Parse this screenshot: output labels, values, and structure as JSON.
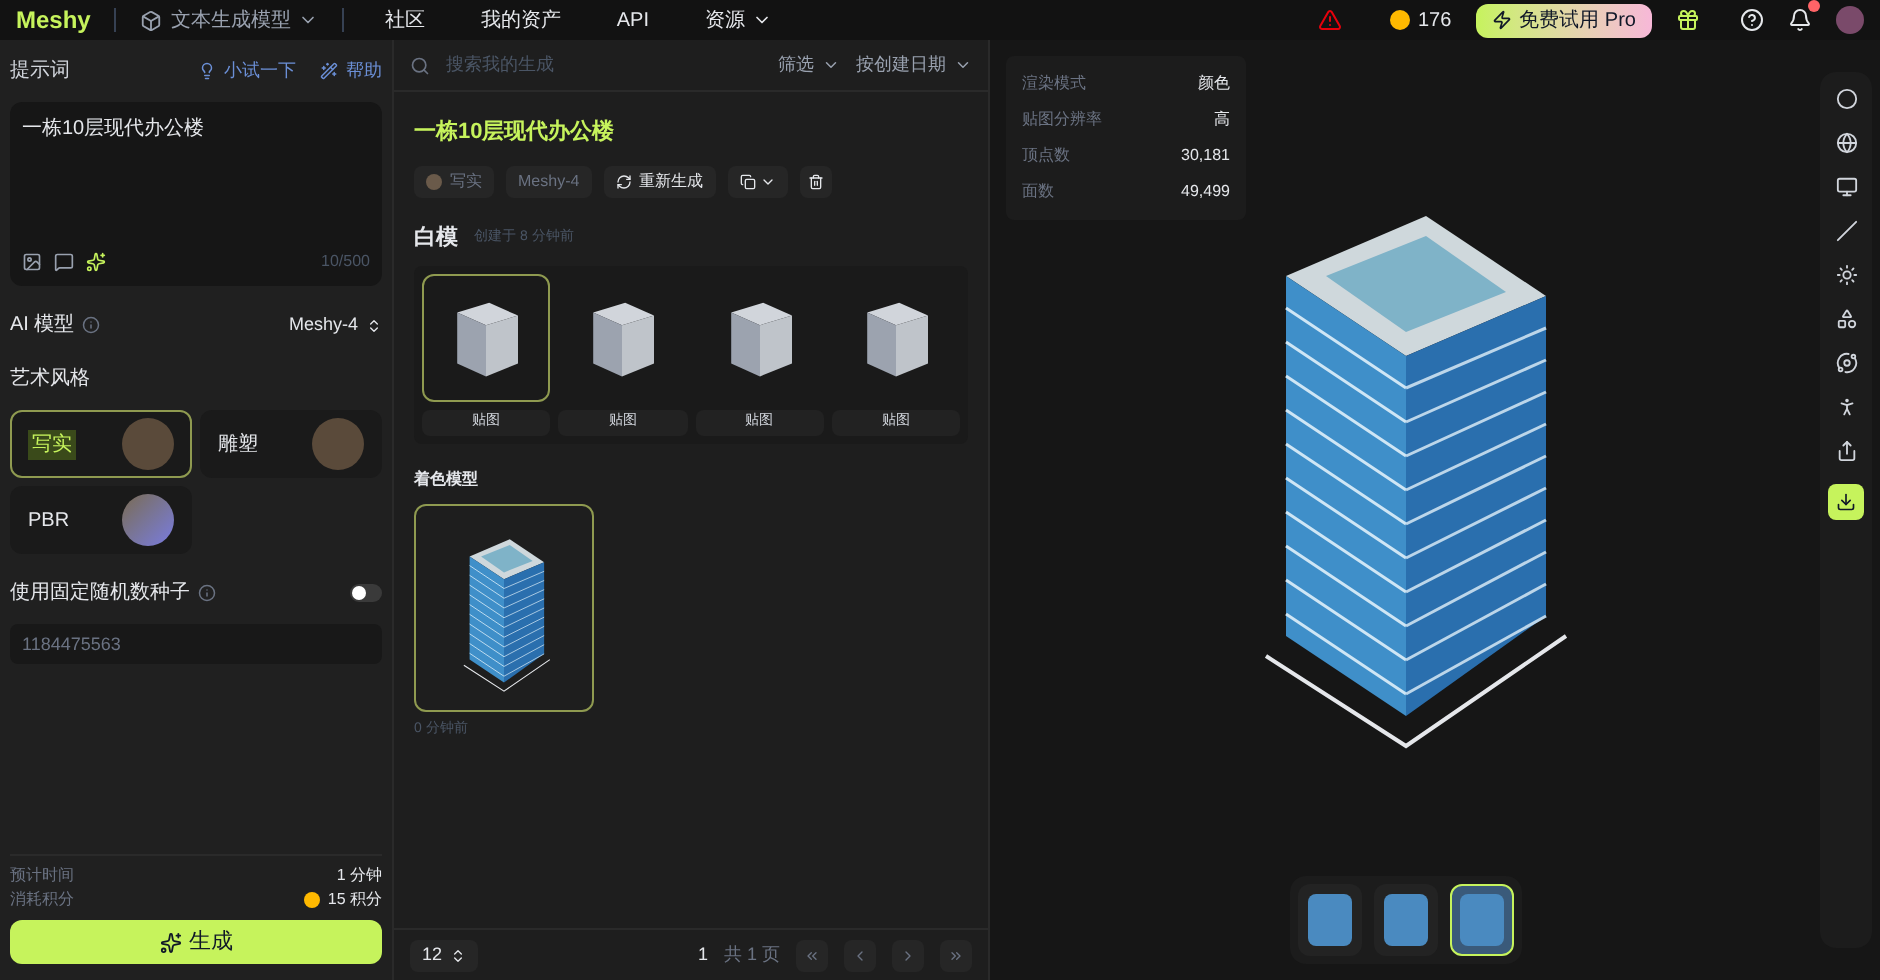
{
  "header": {
    "logo": "Meshy",
    "mode": "文本生成模型",
    "nav": [
      {
        "label": "社区",
        "menu": false
      },
      {
        "label": "我的资产",
        "menu": false
      },
      {
        "label": "API",
        "menu": false
      },
      {
        "label": "资源",
        "menu": true
      }
    ],
    "credits": "176",
    "pro": "免费试用 Pro",
    "notification_badge": true
  },
  "left_panel": {
    "prompt_label": "提示词",
    "prompt_actions": [
      "小试一下",
      "帮助"
    ],
    "prompt": "一栋10层现代办公楼",
    "counter": "10/500",
    "model_label": "AI 模型",
    "model": "Meshy-4",
    "style_label": "艺术风格",
    "styles": [
      {
        "label": "写实",
        "selected": true
      },
      {
        "label": "雕塑",
        "selected": false
      },
      {
        "label": "PBR",
        "selected": false
      }
    ],
    "seed_label": "使用固定随机数种子",
    "seed_on": false,
    "seed_placeholder": "1184475563",
    "estimates": [
      {
        "label": "预计时间",
        "value": "1 分钟"
      },
      {
        "label": "消耗积分",
        "value": "15 积分"
      }
    ],
    "generate": "生成"
  },
  "middle_panel": {
    "search_placeholder": "搜索我的生成",
    "filter": "筛选",
    "sort": "按创建日期",
    "title": "一栋10层现代办公楼",
    "style_tag": "写实",
    "model_tag": "Meshy-4",
    "regenerate": "重新生成",
    "white_section": {
      "title": "白模",
      "meta": "创建于 8 分钟前",
      "items": [
        {
          "selected": true,
          "button": "贴图"
        },
        {
          "selected": false,
          "button": "贴图"
        },
        {
          "selected": false,
          "button": "贴图"
        },
        {
          "selected": false,
          "button": "贴图"
        }
      ]
    },
    "color_section": {
      "title": "着色模型",
      "meta": "0 分钟前",
      "items": [
        {
          "selected": true
        }
      ]
    },
    "page_size": "12",
    "page": "1",
    "page_total": "共 1 页"
  },
  "viewport": {
    "stats": [
      {
        "label": "渲染模式",
        "value": "颜色"
      },
      {
        "label": "贴图分辨率",
        "value": "高"
      },
      {
        "label": "顶点数",
        "value": "30,181"
      },
      {
        "label": "面数",
        "value": "49,499"
      }
    ],
    "view_modes": [
      {
        "selected": false
      },
      {
        "selected": false
      },
      {
        "selected": true
      }
    ]
  }
}
